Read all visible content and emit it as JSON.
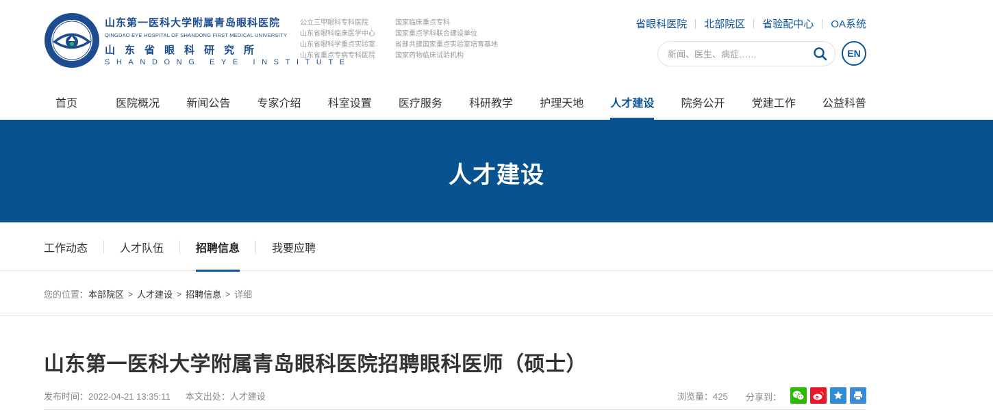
{
  "header": {
    "logo": {
      "cn_name": "山东第一医科大学附属青岛眼科医院",
      "en_name": "QINGDAO EYE HOSPITAL OF SHANDONG FIRST MEDICAL UNIVERSITY",
      "institute_cn": "山东省眼科研究所",
      "institute_en": "SHANDONG EYE INSTITUTE"
    },
    "qualifications_col1": [
      "公立三甲眼科专科医院",
      "山东省眼科临床医学中心",
      "山东省眼科学重点实验室",
      "山东省重点专病专科医院"
    ],
    "qualifications_col2": [
      "国家临床重点专科",
      "国家重点学科联合建设单位",
      "省部共建国家重点实验室培育基地",
      "国家药物临床试验机构"
    ],
    "top_links": [
      "省眼科医院",
      "北部院区",
      "省验配中心",
      "OA系统"
    ],
    "search": {
      "placeholder": "新闻、医生、病症……",
      "icon": "search-icon"
    },
    "lang_button": "EN"
  },
  "nav": {
    "items": [
      "首页",
      "医院概况",
      "新闻公告",
      "专家介绍",
      "科室设置",
      "医疗服务",
      "科研教学",
      "护理天地",
      "人才建设",
      "院务公开",
      "党建工作",
      "公益科普"
    ],
    "active": "人才建设"
  },
  "banner": {
    "title": "人才建设"
  },
  "subnav": {
    "items": [
      "工作动态",
      "人才队伍",
      "招聘信息",
      "我要应聘"
    ],
    "active": "招聘信息"
  },
  "breadcrumb": {
    "label": "您的位置：",
    "items": [
      "本部院区",
      "人才建设",
      "招聘信息"
    ],
    "current": "详细"
  },
  "article": {
    "title": "山东第一医科大学附属青岛眼科医院招聘眼科医师（硕士）",
    "publish_time": "发布时间：2022-04-21 13:35:11",
    "source": "本文出处：人才建设",
    "views": "浏览量：425",
    "share_label": "分享到：",
    "share_icons": [
      "wechat-icon",
      "weibo-icon",
      "favorite-icon",
      "print-icon"
    ]
  },
  "colors": {
    "primary": "#08528f",
    "link": "#0d5597",
    "wechat": "#2cba00",
    "weibo": "#e6162d"
  }
}
